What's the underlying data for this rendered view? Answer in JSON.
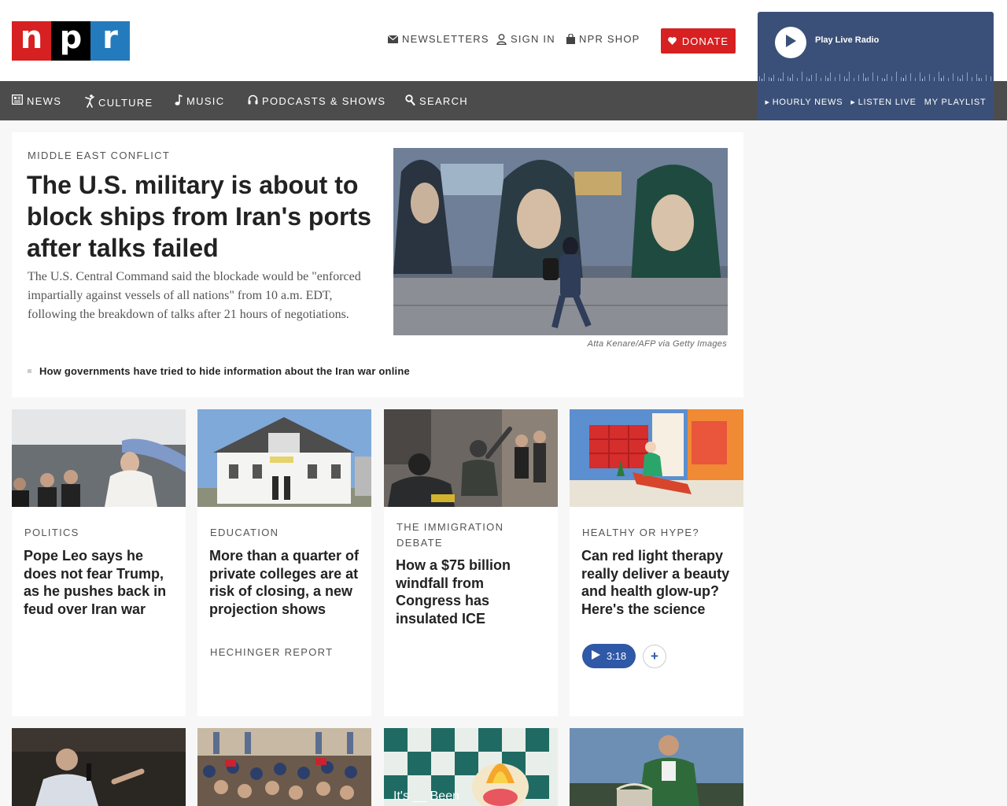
{
  "logo": {
    "letters": [
      "n",
      "p",
      "r"
    ]
  },
  "header": {
    "newsletters": "NEWSLETTERS",
    "sign_in": "SIGN IN",
    "shop": "NPR SHOP",
    "donate": "DONATE"
  },
  "player": {
    "label": "Play Live Radio",
    "links": [
      "HOURLY NEWS",
      "LISTEN LIVE",
      "MY PLAYLIST"
    ]
  },
  "nav": {
    "items": [
      {
        "label": "NEWS",
        "icon": "newspaper-icon"
      },
      {
        "label": "CULTURE",
        "icon": "dancer-icon"
      },
      {
        "label": "MUSIC",
        "icon": "music-note-icon"
      },
      {
        "label": "PODCASTS & SHOWS",
        "icon": "headphones-icon"
      },
      {
        "label": "SEARCH",
        "icon": "search-icon"
      }
    ]
  },
  "hero": {
    "kicker": "MIDDLE EAST CONFLICT",
    "title": "The U.S. military is about to block ships from Iran's ports after talks failed",
    "teaser": "The U.S. Central Command said the blockade would be \"enforced impartially against vessels of all nations\" from 10 a.m. EDT, following the breakdown of talks after 21 hours of negotiations.",
    "credit": "Atta Kenare/AFP via Getty Images",
    "related": "How governments have tried to hide information about the Iran war online"
  },
  "cards": [
    {
      "kicker": "POLITICS",
      "title": "Pope Leo says he does not fear Trump, as he pushes back in feud over Iran war"
    },
    {
      "kicker": "EDUCATION",
      "title": "More than a quarter of private colleges are at risk of closing, a new projection shows",
      "source": "HECHINGER REPORT"
    },
    {
      "kicker": "THE IMMIGRATION DEBATE",
      "title": "How a $75 billion windfall from Congress has insulated ICE"
    },
    {
      "kicker": "HEALTHY OR HYPE?",
      "title": "Can red light therapy really deliver a beauty and health glow-up? Here's the science",
      "audio_duration": "3:18",
      "audio_add": "+"
    }
  ],
  "row3": {
    "image_text": "It's __ Been"
  }
}
